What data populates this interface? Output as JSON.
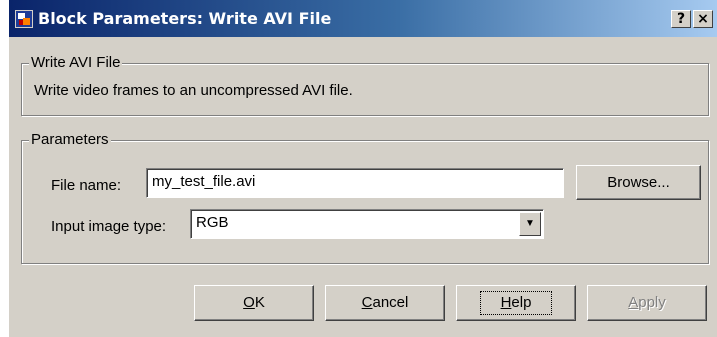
{
  "window": {
    "title": "Block Parameters: Write AVI File",
    "help_button": "?",
    "close_button": "×",
    "icon": "simulink-block-icon"
  },
  "description_group": {
    "legend": "Write AVI File",
    "text": "Write video frames to an uncompressed AVI file."
  },
  "parameters_group": {
    "legend": "Parameters",
    "file_name_label": "File name:",
    "file_name_value": "my_test_file.avi",
    "browse_label": "Browse...",
    "image_type_label": "Input image type:",
    "image_type_value": "RGB"
  },
  "buttons": {
    "ok": {
      "mnemonic": "O",
      "rest": "K"
    },
    "cancel": {
      "mnemonic": "C",
      "rest": "ancel"
    },
    "help": {
      "mnemonic": "H",
      "rest": "elp"
    },
    "apply": {
      "mnemonic": "A",
      "rest": "pply"
    }
  }
}
